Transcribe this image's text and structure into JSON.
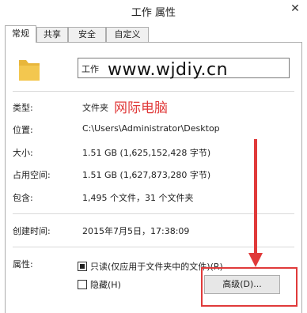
{
  "window": {
    "title": "工作 属性",
    "close_glyph": "✕"
  },
  "tabs": [
    "常规",
    "共享",
    "安全",
    "自定义"
  ],
  "header": {
    "name_value": "工作"
  },
  "watermark": {
    "url": "www.wjdiy.cn",
    "site_name": "网际电脑"
  },
  "info": {
    "type_label": "类型:",
    "type_value": "文件夹",
    "location_label": "位置:",
    "location_value": "C:\\Users\\Administrator\\Desktop",
    "size_label": "大小:",
    "size_value": "1.51 GB (1,625,152,428 字节)",
    "size_on_disk_label": "占用空间:",
    "size_on_disk_value": "1.51 GB (1,627,873,280 字节)",
    "contains_label": "包含:",
    "contains_value": "1,495 个文件，31 个文件夹",
    "created_label": "创建时间:",
    "created_value": "2015年7月5日，17:38:09"
  },
  "attributes": {
    "label": "属性:",
    "readonly_label": "只读(仅应用于文件夹中的文件)(R)",
    "hidden_label": "隐藏(H)",
    "advanced_button": "高级(D)..."
  },
  "colors": {
    "accent_red": "#e03a3a",
    "folder_yellow": "#f3c74f"
  }
}
